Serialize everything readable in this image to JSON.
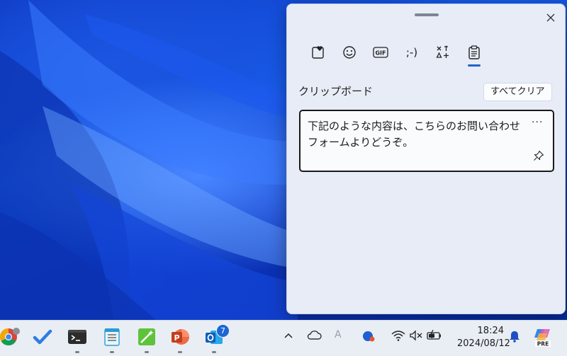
{
  "clipboard_panel": {
    "tabs": [
      {
        "name": "stickers-favorites",
        "label": ""
      },
      {
        "name": "emoji",
        "label": ""
      },
      {
        "name": "gif",
        "label": "GIF"
      },
      {
        "name": "kaomoji",
        "label": ";-)"
      },
      {
        "name": "symbols",
        "label": ""
      },
      {
        "name": "clipboard",
        "label": ""
      }
    ],
    "active_tab": "clipboard",
    "section_title": "クリップボード",
    "clear_all_label": "すべてクリア",
    "items": [
      {
        "text": "下記のような内容は、こちらのお問い合わせフォームよりどうぞ。",
        "more_label": "···"
      }
    ]
  },
  "taskbar": {
    "apps": [
      "chrome",
      "todo",
      "terminal",
      "notepad",
      "image-creator",
      "powerpoint",
      "outlook"
    ],
    "outlook_badge": "7",
    "tray": {
      "ime_label": "A",
      "time": "18:24",
      "date": "2024/08/12",
      "copilot_badge": "PRE"
    }
  },
  "colors": {
    "accent": "#2563c9",
    "panel_bg": "#e7ecf6",
    "taskbar_bg": "#e9eef5"
  }
}
